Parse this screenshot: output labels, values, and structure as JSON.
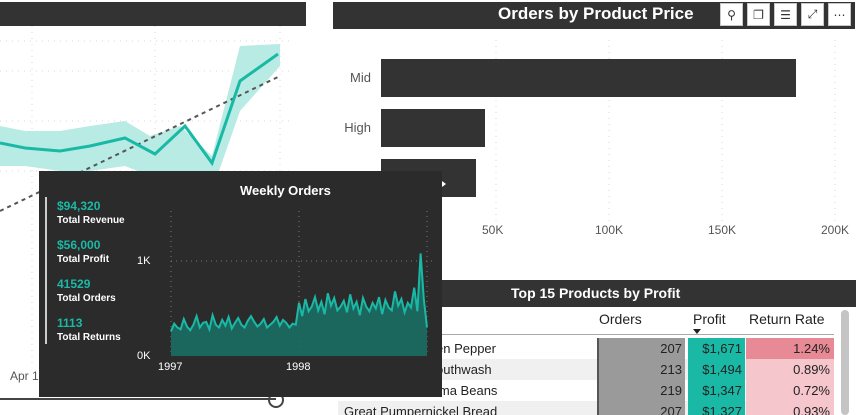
{
  "left_chart": {
    "x_label_partial": "Apr 1"
  },
  "bar_chart": {
    "title": "Orders by Product Price",
    "toolbar": [
      {
        "name": "pin-icon",
        "glyph": "⚲"
      },
      {
        "name": "copy-visual-icon",
        "glyph": "❐"
      },
      {
        "name": "filter-icon",
        "glyph": "☰"
      },
      {
        "name": "focus-mode-icon",
        "glyph": "⤢"
      },
      {
        "name": "more-options-icon",
        "glyph": "⋯"
      }
    ],
    "x_ticks": [
      "50K",
      "100K",
      "150K",
      "200K"
    ]
  },
  "chart_data": [
    {
      "type": "bar",
      "title": "Orders by Product Price",
      "orientation": "horizontal",
      "categories": [
        "Mid",
        "High",
        ""
      ],
      "values": [
        183000,
        46000,
        42000
      ],
      "xlim": [
        0,
        200000
      ],
      "x_ticks": [
        "50K",
        "100K",
        "150K",
        "200K"
      ]
    },
    {
      "type": "area",
      "title": "Weekly Orders",
      "x_ticks": [
        "1997",
        "1998"
      ],
      "y_ticks": [
        "0K",
        "1K"
      ],
      "ylim": [
        0,
        1100
      ],
      "values": [
        260,
        340,
        300,
        280,
        390,
        310,
        270,
        330,
        420,
        300,
        350,
        360,
        280,
        430,
        330,
        300,
        380,
        320,
        410,
        290,
        350,
        400,
        330,
        300,
        370,
        420,
        360,
        310,
        340,
        390,
        300,
        330,
        360,
        410,
        320,
        380,
        350,
        300,
        340,
        330,
        560,
        420,
        600,
        470,
        520,
        620,
        480,
        570,
        440,
        660,
        530,
        610,
        480,
        520,
        580,
        460,
        650,
        500,
        570,
        430,
        610,
        520,
        470,
        560,
        500,
        620,
        440,
        590,
        510,
        480,
        680,
        530,
        600,
        460,
        560,
        510,
        720,
        470,
        1080,
        600,
        300
      ]
    },
    {
      "type": "line",
      "title": "",
      "series": [
        {
          "name": "",
          "values": [
            145,
            152,
            150,
            155,
            145,
            150,
            140,
            155,
            150,
            165,
            130,
            80,
            55
          ]
        }
      ]
    }
  ],
  "tooltip": {
    "title": "Weekly Orders",
    "kpis": [
      {
        "value": "$94,320",
        "label": "Total Revenue"
      },
      {
        "value": "$56,000",
        "label": "Total Profit"
      },
      {
        "value": "41529",
        "label": "Total Orders"
      },
      {
        "value": "1113",
        "label": "Total Returns"
      }
    ],
    "y_ticks": [
      "1K",
      "0K"
    ],
    "x_ticks": [
      "1997",
      "1998"
    ]
  },
  "table": {
    "title": "Top 15 Products by Profit",
    "columns": [
      "Orders",
      "Profit",
      "Return Rate"
    ],
    "rows": [
      {
        "name": "en Pepper",
        "orders": "207",
        "profit": "$1,671",
        "return_rate": "1.24%",
        "return_level": 1.0
      },
      {
        "name": "outhwash",
        "orders": "213",
        "profit": "$1,494",
        "return_rate": "0.89%",
        "return_level": 0.6
      },
      {
        "name": "ima Beans",
        "orders": "219",
        "profit": "$1,347",
        "return_rate": "0.72%",
        "return_level": 0.4
      },
      {
        "name": "Great Pumpernickel Bread",
        "orders": "207",
        "profit": "$1,327",
        "return_rate": "0.93%",
        "return_level": 0.65
      }
    ]
  },
  "colors": {
    "dark": "#333333",
    "teal": "#1ab9a6",
    "teal_light": "#b8ebe4",
    "orders_bar": "#9a9a9a",
    "profit_bg": "#1ab9a6",
    "return_high": "#e88a96",
    "return_low": "#f5c6cc"
  }
}
